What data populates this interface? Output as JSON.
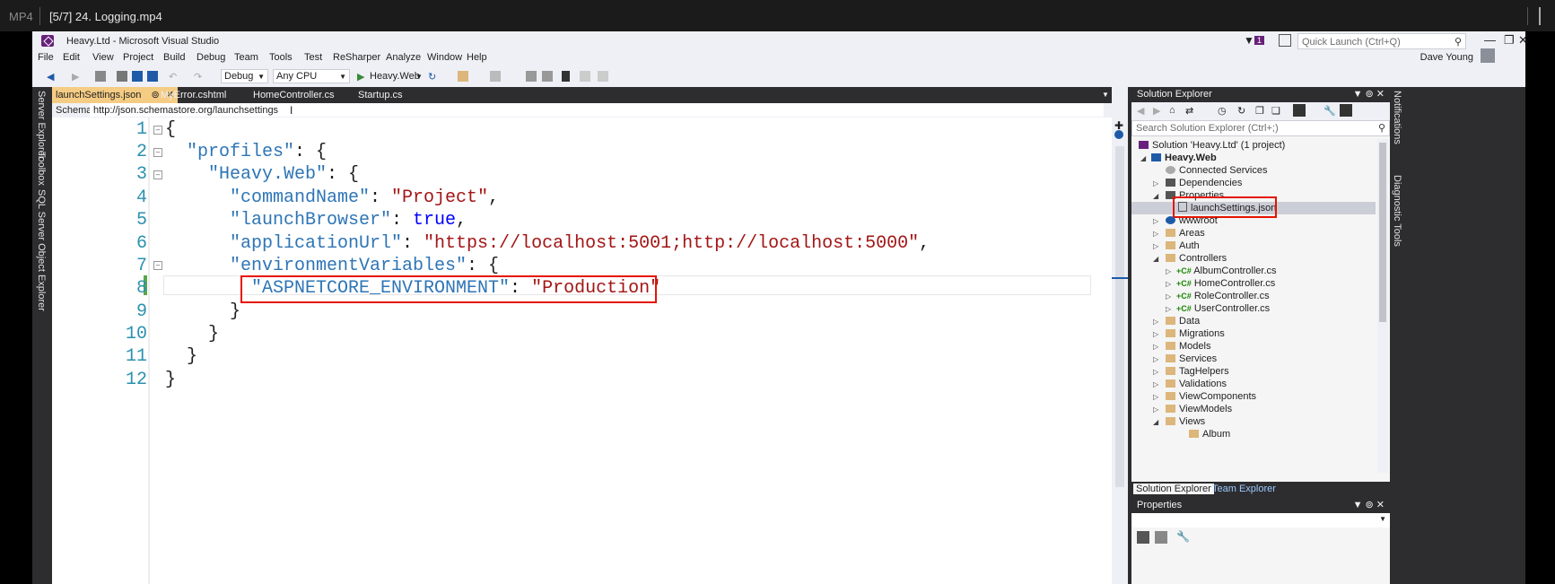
{
  "player": {
    "format": "MP4",
    "title": "[5/7] 24. Logging.mp4"
  },
  "window": {
    "title": "Heavy.Ltd - Microsoft Visual Studio",
    "filter_badge": "1",
    "quick_launch_placeholder": "Quick Launch (Ctrl+Q)",
    "user": "Dave Young"
  },
  "menu": [
    "File",
    "Edit",
    "View",
    "Project",
    "Build",
    "Debug",
    "Team",
    "Tools",
    "Test",
    "ReSharper",
    "Analyze",
    "Window",
    "Help"
  ],
  "toolbar": {
    "config": "Debug",
    "platform": "Any CPU",
    "run_target": "Heavy.Web"
  },
  "left_tabs": [
    "Server Explorer",
    "Toolbox",
    "SQL Server Object Explorer"
  ],
  "doc_tabs": [
    {
      "label": "launchSettings.json",
      "active": true
    },
    {
      "label": "MyError.cshtml",
      "active": false
    },
    {
      "label": "HomeController.cs",
      "active": false
    },
    {
      "label": "Startup.cs",
      "active": false
    }
  ],
  "schema": {
    "label": "Schema:",
    "value": "http://json.schemastore.org/launchsettings"
  },
  "code_lines": [
    "1",
    "2",
    "3",
    "4",
    "5",
    "6",
    "7",
    "8",
    "9",
    "10",
    "11",
    "12"
  ],
  "code": {
    "k_profiles": "\"profiles\"",
    "k_heavyweb": "\"Heavy.Web\"",
    "k_commandName": "\"commandName\"",
    "v_project": "\"Project\"",
    "k_launchBrowser": "\"launchBrowser\"",
    "v_true": "true",
    "k_applicationUrl": "\"applicationUrl\"",
    "v_url": "\"https://localhost:5001;http://localhost:5000\"",
    "k_envVars": "\"environmentVariables\"",
    "k_aspnet": "\"ASPNETCORE_ENVIRONMENT\"",
    "v_production": "\"Production\""
  },
  "solution_explorer": {
    "title": "Solution Explorer",
    "search_placeholder": "Search Solution Explorer (Ctrl+;)",
    "items": [
      {
        "label": "Solution 'Heavy.Ltd' (1 project)"
      },
      {
        "label": "Heavy.Web"
      },
      {
        "label": "Connected Services"
      },
      {
        "label": "Dependencies"
      },
      {
        "label": "Properties"
      },
      {
        "label": "launchSettings.json"
      },
      {
        "label": "wwwroot"
      },
      {
        "label": "Areas"
      },
      {
        "label": "Auth"
      },
      {
        "label": "Controllers"
      },
      {
        "label": "AlbumController.cs"
      },
      {
        "label": "HomeController.cs"
      },
      {
        "label": "RoleController.cs"
      },
      {
        "label": "UserController.cs"
      },
      {
        "label": "Data"
      },
      {
        "label": "Migrations"
      },
      {
        "label": "Models"
      },
      {
        "label": "Services"
      },
      {
        "label": "TagHelpers"
      },
      {
        "label": "Validations"
      },
      {
        "label": "ViewComponents"
      },
      {
        "label": "ViewModels"
      },
      {
        "label": "Views"
      },
      {
        "label": "Album"
      }
    ],
    "tab_solution": "Solution Explorer",
    "tab_team": "Team Explorer"
  },
  "properties": {
    "title": "Properties"
  },
  "right_tabs": [
    "Notifications",
    "Diagnostic Tools"
  ],
  "colors": {
    "accent": "#68217a",
    "active_tab": "#f5cc84",
    "highlight": "#e51400"
  }
}
